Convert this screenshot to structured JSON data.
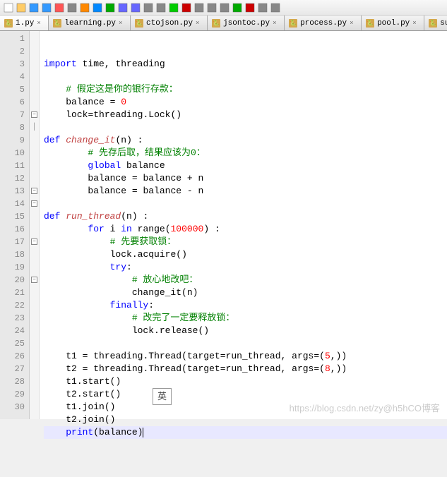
{
  "toolbar_icons": [
    "new",
    "open",
    "save",
    "saveall",
    "close",
    "print",
    "cut",
    "copy",
    "paste",
    "undo",
    "redo",
    "find",
    "replace",
    "zoom-in",
    "zoom-out",
    "wrap",
    "ws",
    "indent",
    "run",
    "macro",
    "record",
    "settings"
  ],
  "tabs": [
    {
      "label": "1.py",
      "active": true
    },
    {
      "label": "learning.py",
      "active": false
    },
    {
      "label": "ctojson.py",
      "active": false
    },
    {
      "label": "jsontoc.py",
      "active": false
    },
    {
      "label": "process.py",
      "active": false
    },
    {
      "label": "pool.py",
      "active": false
    },
    {
      "label": "subpro.py",
      "active": false
    }
  ],
  "line_count": 30,
  "fold": {
    "7": "minus",
    "8": "bar",
    "13": "minus",
    "14": "minus",
    "17": "minus",
    "20": "minus"
  },
  "code_lines": [
    [
      [
        "kw",
        "import"
      ],
      [
        "sp",
        " "
      ],
      [
        "id",
        "time"
      ],
      [
        "op",
        ", "
      ],
      [
        "id",
        "threading"
      ]
    ],
    [],
    [
      [
        "sp",
        "    "
      ],
      [
        "cm",
        "# 假定这是你的银行存款："
      ]
    ],
    [
      [
        "sp",
        "    "
      ],
      [
        "id",
        "balance "
      ],
      [
        "op",
        "= "
      ],
      [
        "num",
        "0"
      ]
    ],
    [
      [
        "sp",
        "    "
      ],
      [
        "id",
        "lock"
      ],
      [
        "op",
        "="
      ],
      [
        "id",
        "threading"
      ],
      [
        "op",
        "."
      ],
      [
        "id",
        "Lock"
      ],
      [
        "op",
        "()"
      ]
    ],
    [],
    [
      [
        "kw",
        "def"
      ],
      [
        "sp",
        " "
      ],
      [
        "fn",
        "change_it"
      ],
      [
        "op",
        "("
      ],
      [
        "id",
        "n"
      ],
      [
        "op",
        ") :"
      ]
    ],
    [
      [
        "sp",
        "        "
      ],
      [
        "cm",
        "# 先存后取，结果应该为0："
      ]
    ],
    [
      [
        "sp",
        "        "
      ],
      [
        "kw",
        "global"
      ],
      [
        "sp",
        " "
      ],
      [
        "id",
        "balance"
      ]
    ],
    [
      [
        "sp",
        "        "
      ],
      [
        "id",
        "balance "
      ],
      [
        "op",
        "= "
      ],
      [
        "id",
        "balance "
      ],
      [
        "op",
        "+ "
      ],
      [
        "id",
        "n"
      ]
    ],
    [
      [
        "sp",
        "        "
      ],
      [
        "id",
        "balance "
      ],
      [
        "op",
        "= "
      ],
      [
        "id",
        "balance "
      ],
      [
        "op",
        "- "
      ],
      [
        "id",
        "n"
      ]
    ],
    [],
    [
      [
        "kw",
        "def"
      ],
      [
        "sp",
        " "
      ],
      [
        "fn",
        "run_thread"
      ],
      [
        "op",
        "("
      ],
      [
        "id",
        "n"
      ],
      [
        "op",
        ") :"
      ]
    ],
    [
      [
        "sp",
        "        "
      ],
      [
        "kw",
        "for"
      ],
      [
        "sp",
        " "
      ],
      [
        "id",
        "i "
      ],
      [
        "kw",
        "in"
      ],
      [
        "sp",
        " "
      ],
      [
        "id",
        "range"
      ],
      [
        "op",
        "("
      ],
      [
        "num",
        "100000"
      ],
      [
        "op",
        ") :"
      ]
    ],
    [
      [
        "sp",
        "            "
      ],
      [
        "cm",
        "# 先要获取锁："
      ]
    ],
    [
      [
        "sp",
        "            "
      ],
      [
        "id",
        "lock"
      ],
      [
        "op",
        "."
      ],
      [
        "id",
        "acquire"
      ],
      [
        "op",
        "()"
      ]
    ],
    [
      [
        "sp",
        "            "
      ],
      [
        "kw",
        "try"
      ],
      [
        "op",
        ":"
      ]
    ],
    [
      [
        "sp",
        "                "
      ],
      [
        "cm",
        "# 放心地改吧："
      ]
    ],
    [
      [
        "sp",
        "                "
      ],
      [
        "id",
        "change_it"
      ],
      [
        "op",
        "("
      ],
      [
        "id",
        "n"
      ],
      [
        "op",
        ")"
      ]
    ],
    [
      [
        "sp",
        "            "
      ],
      [
        "kw",
        "finally"
      ],
      [
        "op",
        ":"
      ]
    ],
    [
      [
        "sp",
        "                "
      ],
      [
        "cm",
        "# 改完了一定要释放锁："
      ]
    ],
    [
      [
        "sp",
        "                "
      ],
      [
        "id",
        "lock"
      ],
      [
        "op",
        "."
      ],
      [
        "id",
        "release"
      ],
      [
        "op",
        "()"
      ]
    ],
    [],
    [
      [
        "sp",
        "    "
      ],
      [
        "id",
        "t1 "
      ],
      [
        "op",
        "= "
      ],
      [
        "id",
        "threading"
      ],
      [
        "op",
        "."
      ],
      [
        "id",
        "Thread"
      ],
      [
        "op",
        "("
      ],
      [
        "id",
        "target"
      ],
      [
        "op",
        "="
      ],
      [
        "id",
        "run_thread"
      ],
      [
        "op",
        ", "
      ],
      [
        "id",
        "args"
      ],
      [
        "op",
        "=("
      ],
      [
        "num",
        "5"
      ],
      [
        "op",
        ",))"
      ]
    ],
    [
      [
        "sp",
        "    "
      ],
      [
        "id",
        "t2 "
      ],
      [
        "op",
        "= "
      ],
      [
        "id",
        "threading"
      ],
      [
        "op",
        "."
      ],
      [
        "id",
        "Thread"
      ],
      [
        "op",
        "("
      ],
      [
        "id",
        "target"
      ],
      [
        "op",
        "="
      ],
      [
        "id",
        "run_thread"
      ],
      [
        "op",
        ", "
      ],
      [
        "id",
        "args"
      ],
      [
        "op",
        "=("
      ],
      [
        "num",
        "8"
      ],
      [
        "op",
        ",))"
      ]
    ],
    [
      [
        "sp",
        "    "
      ],
      [
        "id",
        "t1"
      ],
      [
        "op",
        "."
      ],
      [
        "id",
        "start"
      ],
      [
        "op",
        "()"
      ]
    ],
    [
      [
        "sp",
        "    "
      ],
      [
        "id",
        "t2"
      ],
      [
        "op",
        "."
      ],
      [
        "id",
        "start"
      ],
      [
        "op",
        "()"
      ]
    ],
    [
      [
        "sp",
        "    "
      ],
      [
        "id",
        "t1"
      ],
      [
        "op",
        "."
      ],
      [
        "id",
        "join"
      ],
      [
        "op",
        "()"
      ]
    ],
    [
      [
        "sp",
        "    "
      ],
      [
        "id",
        "t2"
      ],
      [
        "op",
        "."
      ],
      [
        "id",
        "join"
      ],
      [
        "op",
        "()"
      ]
    ],
    [
      [
        "sp",
        "    "
      ],
      [
        "kw",
        "print"
      ],
      [
        "op",
        "("
      ],
      [
        "id",
        "balance"
      ],
      [
        "op",
        ")"
      ],
      [
        "caret",
        ""
      ]
    ]
  ],
  "current_line": 30,
  "ime_text": "英",
  "watermark": "https://blog.csdn.net/zy@h5hCO博客"
}
